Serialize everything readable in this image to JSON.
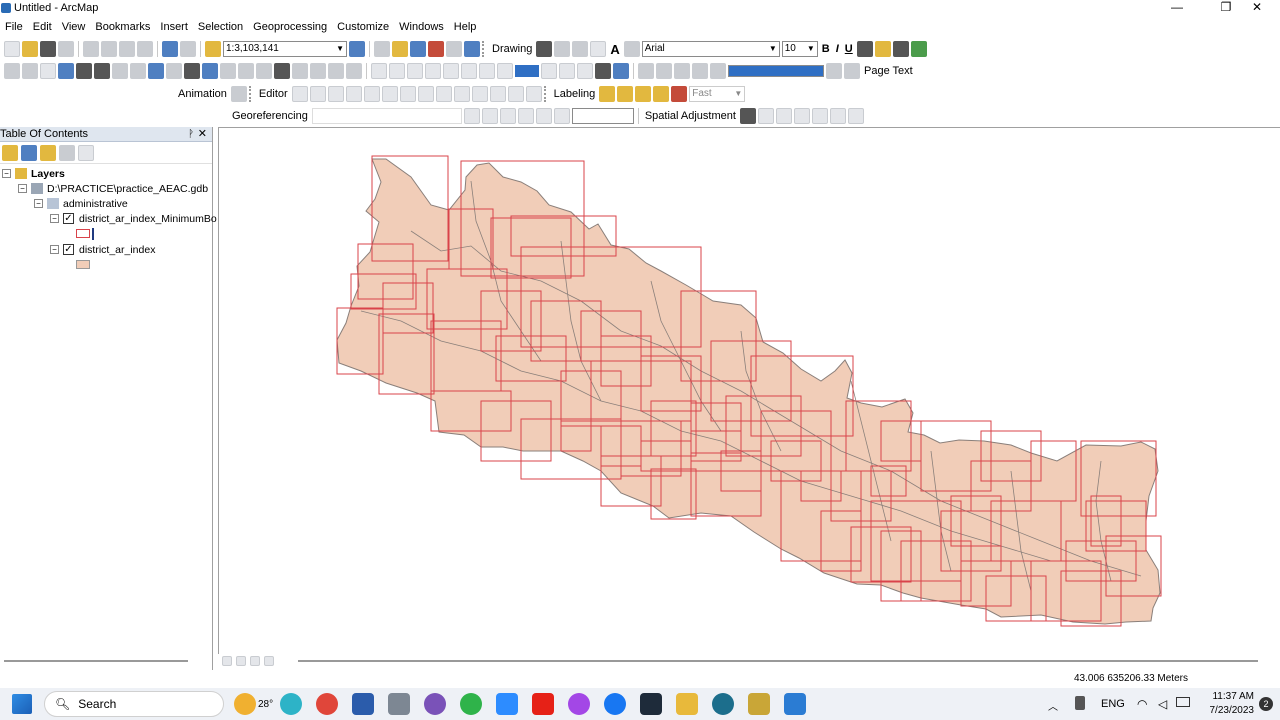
{
  "window": {
    "title": "Untitled - ArcMap",
    "min": "—",
    "max": "❐",
    "close": "✕"
  },
  "menu": [
    "File",
    "Edit",
    "View",
    "Bookmarks",
    "Insert",
    "Selection",
    "Geoprocessing",
    "Customize",
    "Windows",
    "Help"
  ],
  "toolbar": {
    "scale": "1:3,103,141",
    "drawing": "Drawing",
    "font": "Arial",
    "font_size": "10",
    "bold": "B",
    "italic": "I",
    "underline": "U",
    "text_a": "A",
    "page_text": "Page Text",
    "animation": "Animation",
    "editor": "Editor",
    "labeling": "Labeling",
    "fast": "Fast",
    "georeferencing": "Georeferencing",
    "spatial_adjustment": "Spatial Adjustment"
  },
  "toc": {
    "title": "Table Of Contents",
    "pin": "ᚹ",
    "close": "✕",
    "layers_label": "Layers",
    "gdb": "D:\\PRACTICE\\practice_AEAC.gdb",
    "group": "administrative",
    "layer1": "district_ar_index_MinimumBo",
    "layer2": "district_ar_index",
    "checked": "✓",
    "expanded": "−"
  },
  "status": {
    "coords": "43.006  635206.33 Meters"
  },
  "taskbar": {
    "search_placeholder": "Search",
    "temp": "28°",
    "lang": "ENG",
    "time": "11:37 AM",
    "date": "7/23/2023",
    "badge": "2"
  },
  "colors": {
    "fill": "#f1cdb8",
    "boundary": "#8a7f7a",
    "bbox": "#d9434a",
    "toc_head": "#dfe6ef"
  }
}
